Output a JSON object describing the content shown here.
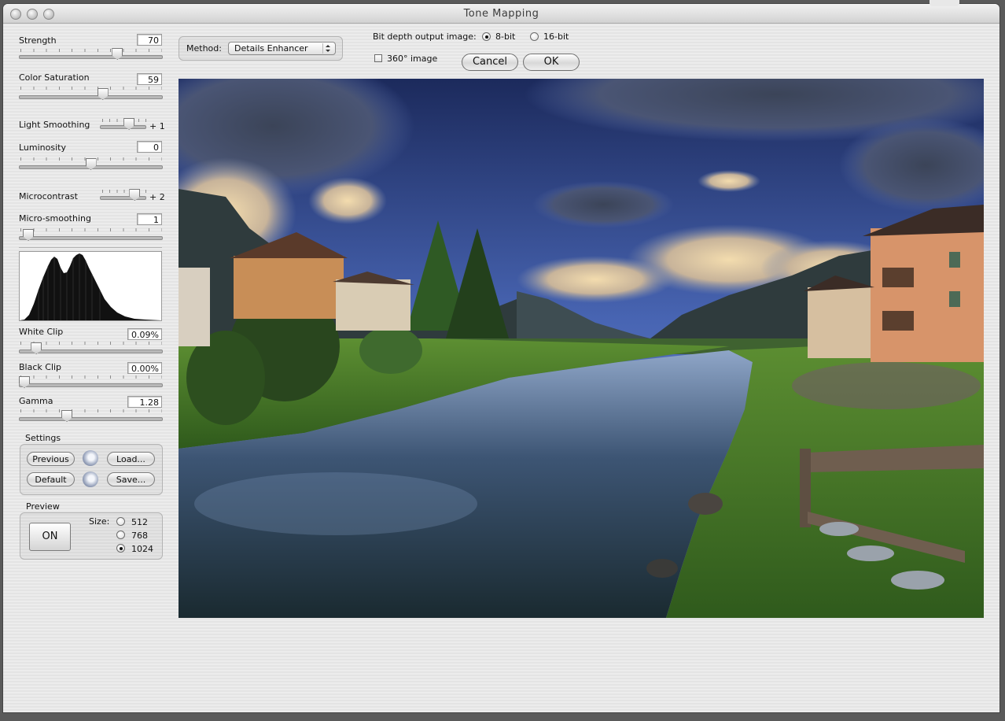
{
  "window": {
    "title": "Tone Mapping"
  },
  "sliders": {
    "strength": {
      "label": "Strength",
      "value": "70",
      "level": 0.7
    },
    "color_saturation": {
      "label": "Color Saturation",
      "value": "59",
      "level": 0.59
    },
    "light_smoothing": {
      "label": "Light Smoothing",
      "value": "+ 1",
      "level": 0.67
    },
    "luminosity": {
      "label": "Luminosity",
      "value": "0",
      "level": 0.5
    },
    "microcontrast": {
      "label": "Microcontrast",
      "value": "+ 2",
      "level": 0.83
    },
    "micro_smoothing": {
      "label": "Micro-smoothing",
      "value": "1",
      "level": 0.03
    },
    "white_clip": {
      "label": "White Clip",
      "value": "0.09%",
      "level": 0.09
    },
    "black_clip": {
      "label": "Black Clip",
      "value": "0.00%",
      "level": 0.0
    },
    "gamma": {
      "label": "Gamma",
      "value": "1.28",
      "level": 0.32
    }
  },
  "settings": {
    "label": "Settings",
    "previous": "Previous",
    "load": "Load...",
    "default": "Default",
    "save": "Save..."
  },
  "preview": {
    "label": "Preview",
    "on_button": "ON",
    "size_label": "Size:",
    "sizes": [
      "512",
      "768",
      "1024"
    ],
    "selected_size": "1024"
  },
  "method": {
    "label": "Method:",
    "selected": "Details Enhancer"
  },
  "bit_depth": {
    "label": "Bit depth output image:",
    "options": [
      "8-bit",
      "16-bit"
    ],
    "selected": "8-bit"
  },
  "panorama": {
    "label": "360° image",
    "checked": false
  },
  "buttons": {
    "cancel": "Cancel",
    "ok": "OK"
  }
}
